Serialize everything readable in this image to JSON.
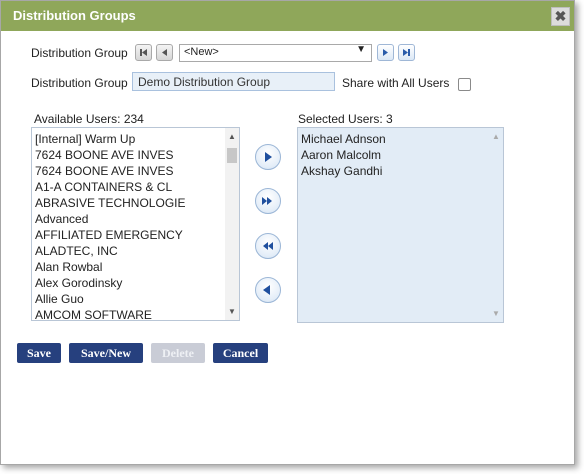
{
  "dialog": {
    "title": "Distribution Groups",
    "close_label": "✖"
  },
  "form": {
    "group_label": "Distribution Group",
    "group_select_value": "<New>",
    "group_name_label": "Distribution Group",
    "group_name_value": "Demo Distribution Group",
    "share_label": "Share with All Users",
    "share_checked": false
  },
  "available": {
    "heading": "Available Users: 234",
    "items": [
      "[Internal] Warm Up",
      "7624 BOONE AVE INVES",
      "7624 BOONE AVE INVES",
      "A1-A CONTAINERS & CL",
      "ABRASIVE TECHNOLOGIE",
      "Advanced",
      "AFFILIATED EMERGENCY",
      "ALADTEC, INC",
      "Alan Rowbal",
      "Alex Gorodinsky",
      "Allie Guo",
      "AMCOM SOFTWARE"
    ]
  },
  "selected": {
    "heading": "Selected Users: 3",
    "items": [
      "Michael Adnson",
      "Aaron Malcolm",
      "Akshay Gandhi"
    ]
  },
  "buttons": {
    "save": "Save",
    "save_new": "Save/New",
    "delete": "Delete",
    "cancel": "Cancel"
  },
  "colors": {
    "titlebar": "#8fa75a",
    "primary_button": "#26407e",
    "selected_list_bg": "#e2ecf6"
  },
  "icons": [
    "first-record-icon",
    "previous-record-icon",
    "next-record-icon",
    "last-record-icon",
    "move-right-icon",
    "move-all-right-icon",
    "move-all-left-icon",
    "move-left-icon"
  ]
}
